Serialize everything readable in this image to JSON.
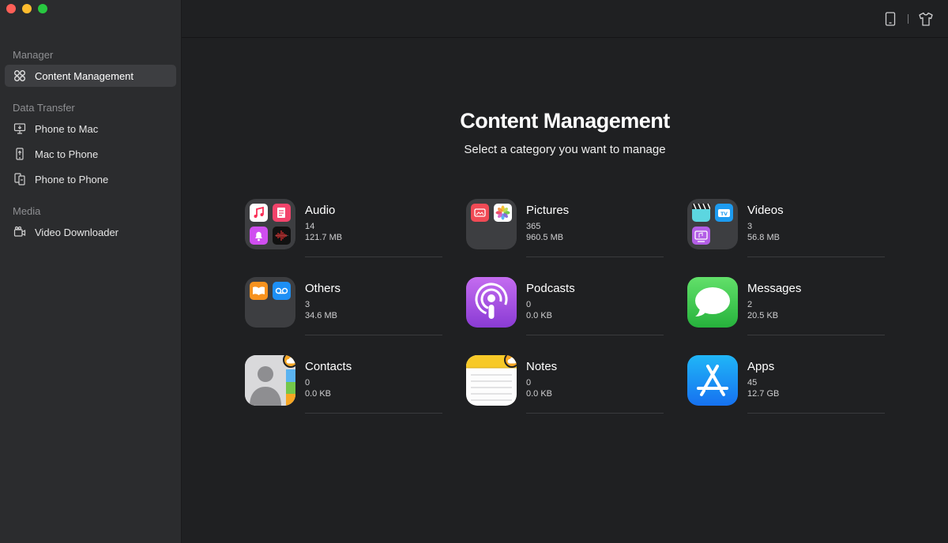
{
  "sidebar": {
    "sections": [
      {
        "title": "Manager",
        "items": [
          {
            "label": "Content Management",
            "icon": "grid-icon",
            "active": true
          }
        ]
      },
      {
        "title": "Data Transfer",
        "items": [
          {
            "label": "Phone to Mac",
            "icon": "phone-to-mac-icon"
          },
          {
            "label": "Mac to Phone",
            "icon": "mac-to-phone-icon"
          },
          {
            "label": "Phone to Phone",
            "icon": "phone-to-phone-icon"
          }
        ]
      },
      {
        "title": "Media",
        "items": [
          {
            "label": "Video Downloader",
            "icon": "video-camera-icon"
          }
        ]
      }
    ]
  },
  "topbar": {
    "icons": [
      "device-icon",
      "tshirt-icon"
    ]
  },
  "main": {
    "title": "Content Management",
    "subtitle": "Select a category you want to manage",
    "categories": [
      {
        "name": "Audio",
        "count": "14",
        "size": "121.7 MB",
        "icon": "audio-folder-icon"
      },
      {
        "name": "Pictures",
        "count": "365",
        "size": "960.5 MB",
        "icon": "pictures-folder-icon"
      },
      {
        "name": "Videos",
        "count": "3",
        "size": "56.8 MB",
        "icon": "videos-folder-icon"
      },
      {
        "name": "Others",
        "count": "3",
        "size": "34.6 MB",
        "icon": "others-folder-icon"
      },
      {
        "name": "Podcasts",
        "count": "0",
        "size": "0.0 KB",
        "icon": "podcasts-icon"
      },
      {
        "name": "Messages",
        "count": "2",
        "size": "20.5 KB",
        "icon": "messages-icon"
      },
      {
        "name": "Contacts",
        "count": "0",
        "size": "0.0 KB",
        "icon": "contacts-icon"
      },
      {
        "name": "Notes",
        "count": "0",
        "size": "0.0 KB",
        "icon": "notes-icon"
      },
      {
        "name": "Apps",
        "count": "45",
        "size": "12.7 GB",
        "icon": "app-store-icon"
      }
    ]
  },
  "colors": {
    "accent_orange": "#f6a623",
    "podcasts_purple": "#9b4de0",
    "messages_green": "#3fc84f",
    "apps_blue": "#1a8cf5"
  }
}
